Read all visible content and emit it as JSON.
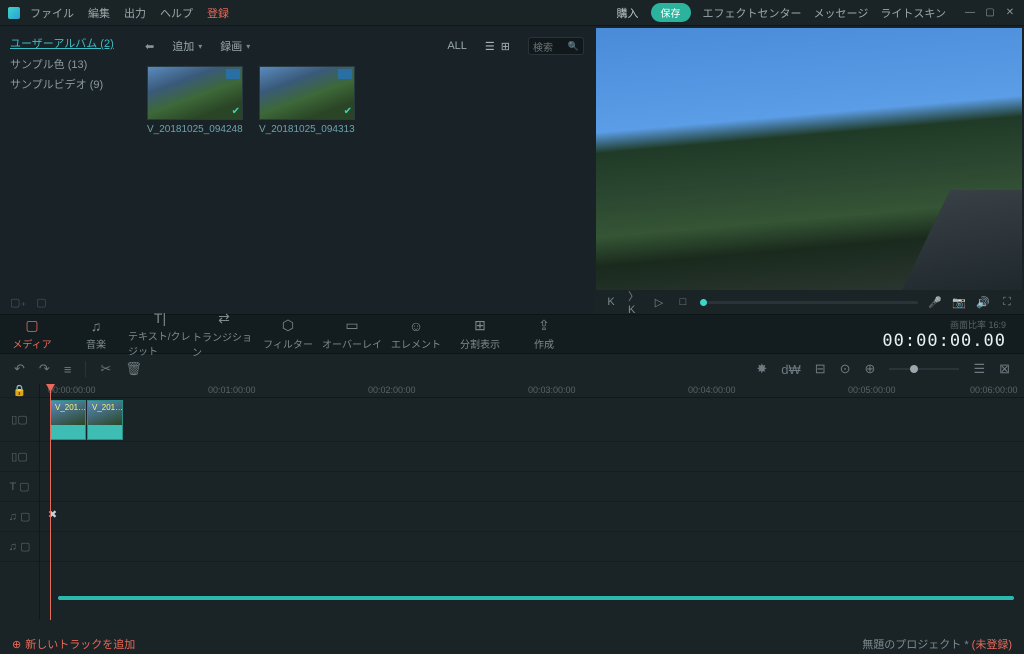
{
  "menu": {
    "file": "ファイル",
    "edit": "編集",
    "output": "出力",
    "help": "ヘルプ",
    "register": "登録"
  },
  "topRight": {
    "buy": "購入",
    "save": "保存",
    "fx": "エフェクトセンター",
    "msg": "メッセージ",
    "skin": "ライトスキン"
  },
  "sidebar": {
    "albumLink": "ユーザーアルバム (2)",
    "sampleColor": "サンプル色 (13)",
    "sampleVideo": "サンプルビデオ (9)"
  },
  "mediaToolbar": {
    "add": "追加",
    "record": "録画",
    "all": "ALL",
    "searchPlaceholder": "検索"
  },
  "clips": [
    {
      "label": "V_20181025_094248"
    },
    {
      "label": "V_20181025_094313"
    }
  ],
  "tabs": [
    {
      "icon": "▢",
      "label": "メディア",
      "active": true
    },
    {
      "icon": "♫",
      "label": "音楽"
    },
    {
      "icon": "T|",
      "label": "テキスト/クレジット"
    },
    {
      "icon": "⇄",
      "label": "トランジション"
    },
    {
      "icon": "⬡",
      "label": "フィルター"
    },
    {
      "icon": "▭",
      "label": "オーバーレイ"
    },
    {
      "icon": "☺",
      "label": "エレメント"
    },
    {
      "icon": "⊞",
      "label": "分割表示"
    },
    {
      "icon": "⇪",
      "label": "作成"
    }
  ],
  "timecode": {
    "ratio": "画面比率  16:9",
    "tc": "00:00:00.00"
  },
  "ruler": [
    "00:00:00:00",
    "00:01:00:00",
    "00:02:00:00",
    "00:03:00:00",
    "00:04:00:00",
    "00:05:00:00",
    "00:06:00:00"
  ],
  "timelineClips": [
    {
      "label": "V_201…"
    },
    {
      "label": "V_201…"
    }
  ],
  "footer": {
    "add": "新しいトラックを追加",
    "project": "無題のプロジェクト *",
    "unreg": "(未登録)"
  }
}
